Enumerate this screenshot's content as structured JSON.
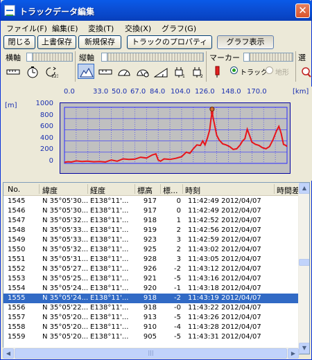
{
  "window": {
    "title": "トラックデータ編集",
    "close_label": "✕"
  },
  "menu": [
    "ファイル(F)",
    "編集(E)",
    "変換(T)",
    "交換(X)",
    "グラフ(G)"
  ],
  "buttons": {
    "close": "閉じる",
    "overwrite_save": "上書保存",
    "new_save": "新規保存",
    "track_properties": "トラックのプロパティ",
    "graph_view": "グラフ表示"
  },
  "toolbar": {
    "h_axis": "横軸",
    "v_axis": "縦軸",
    "marker": "マーカー",
    "select": "選",
    "radio_track": "トラック",
    "radio_terrain": "地形",
    "radio_selected": "track"
  },
  "icons": {
    "h_axis": [
      "distance-icon",
      "clock-icon",
      "point-number-icon"
    ],
    "v_axis": [
      "elevation-icon",
      "distance-bar-icon",
      "speed-icon",
      "speed-meter-icon",
      "slope-icon",
      "heart-rate-1-icon",
      "heart-rate-2-icon"
    ],
    "marker": "marker-pin-icon",
    "search": "search-icon"
  },
  "chart_data": {
    "type": "line",
    "x_unit": "[km]",
    "y_unit": "[m]",
    "x_ticks": [
      "0.0",
      "33.0",
      "50.0",
      "67.0",
      "84.0",
      "104.0",
      "126.0",
      "148.0",
      "170.0"
    ],
    "y_ticks": [
      "1000",
      "800",
      "600",
      "400",
      "200",
      "0"
    ],
    "xlim": [
      0,
      190
    ],
    "ylim": [
      0,
      1000
    ],
    "grid": true,
    "line_color": "#e8141a",
    "grid_color": "#2a2aff",
    "background": "#c0c0c0",
    "marker_x": 126,
    "x": [
      0,
      3,
      6,
      10,
      15,
      20,
      25,
      30,
      35,
      40,
      45,
      50,
      55,
      60,
      65,
      70,
      75,
      78,
      80,
      82,
      85,
      90,
      95,
      100,
      104,
      107,
      110,
      113,
      116,
      118,
      120,
      122,
      124,
      125,
      126,
      127,
      128,
      130,
      132,
      135,
      138,
      141,
      144,
      147,
      150,
      152,
      154,
      156,
      158,
      160,
      163,
      166,
      169,
      172,
      175,
      178,
      181,
      183,
      184,
      185,
      187,
      189,
      190
    ],
    "y": [
      20,
      30,
      25,
      45,
      35,
      40,
      30,
      35,
      25,
      60,
      40,
      80,
      70,
      75,
      110,
      95,
      150,
      170,
      60,
      40,
      80,
      70,
      90,
      120,
      200,
      180,
      260,
      330,
      320,
      400,
      330,
      450,
      600,
      780,
      918,
      800,
      700,
      500,
      420,
      350,
      330,
      300,
      250,
      260,
      330,
      400,
      440,
      610,
      500,
      380,
      340,
      320,
      280,
      260,
      300,
      420,
      580,
      660,
      600,
      530,
      340,
      320,
      300
    ]
  },
  "table": {
    "columns": [
      "No.",
      "緯度",
      "経度",
      "標高",
      "標...",
      "時刻",
      "時間差"
    ],
    "rows": [
      [
        "1545",
        "N 35°05'30...",
        "E138°11'...",
        "917",
        "0",
        "11:42:49 2012/04/07"
      ],
      [
        "1546",
        "N 35°05'30...",
        "E138°11'...",
        "917",
        "0",
        "11:42:49 2012/04/07"
      ],
      [
        "1547",
        "N 35°05'32...",
        "E138°11'...",
        "918",
        "1",
        "11:42:52 2012/04/07"
      ],
      [
        "1548",
        "N 35°05'33...",
        "E138°11'...",
        "919",
        "2",
        "11:42:56 2012/04/07"
      ],
      [
        "1549",
        "N 35°05'33...",
        "E138°11'...",
        "923",
        "3",
        "11:42:59 2012/04/07"
      ],
      [
        "1550",
        "N 35°05'32...",
        "E138°11'...",
        "925",
        "2",
        "11:43:02 2012/04/07"
      ],
      [
        "1551",
        "N 35°05'31...",
        "E138°11'...",
        "928",
        "3",
        "11:43:05 2012/04/07"
      ],
      [
        "1552",
        "N 35°05'27...",
        "E138°11'...",
        "926",
        "-2",
        "11:43:12 2012/04/07"
      ],
      [
        "1553",
        "N 35°05'25...",
        "E138°11'...",
        "921",
        "-5",
        "11:43:16 2012/04/07"
      ],
      [
        "1554",
        "N 35°05'24...",
        "E138°11'...",
        "920",
        "-1",
        "11:43:18 2012/04/07"
      ],
      [
        "1555",
        "N 35°05'24...",
        "E138°11'...",
        "918",
        "-2",
        "11:43:19 2012/04/07"
      ],
      [
        "1556",
        "N 35°05'22...",
        "E138°11'...",
        "918",
        "-0",
        "11:43:22 2012/04/07"
      ],
      [
        "1557",
        "N 35°05'20...",
        "E138°11'...",
        "913",
        "-5",
        "11:43:26 2012/04/07"
      ],
      [
        "1558",
        "N 35°05'20...",
        "E138°11'...",
        "910",
        "-4",
        "11:43:28 2012/04/07"
      ],
      [
        "1559",
        "N 35°05'20...",
        "E138°11'...",
        "905",
        "-5",
        "11:43:31 2012/04/07"
      ]
    ],
    "selected_index": 10
  },
  "scroll": {
    "up": "▲",
    "down": "▼",
    "left": "◀",
    "right": "▶",
    "grip": "|||"
  }
}
